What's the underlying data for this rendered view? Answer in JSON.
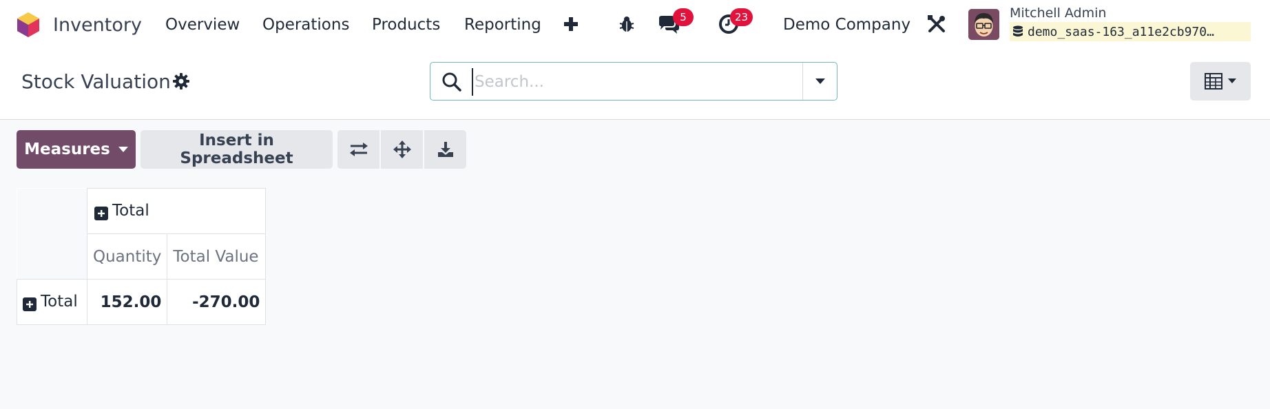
{
  "navbar": {
    "app_name": "Inventory",
    "menu": [
      "Overview",
      "Operations",
      "Products",
      "Reporting"
    ],
    "messages_count": "5",
    "activities_count": "23",
    "company": "Demo Company",
    "user_name": "Mitchell Admin",
    "database": "demo_saas-163_a11e2cb970…"
  },
  "control_panel": {
    "title": "Stock Valuation",
    "search_placeholder": "Search..."
  },
  "toolbar": {
    "measures_label": "Measures",
    "insert_label": "Insert in Spreadsheet"
  },
  "pivot": {
    "col_header": "Total",
    "measures": [
      "Quantity",
      "Total Value"
    ],
    "row_header": "Total",
    "values": [
      "152.00",
      "-270.00"
    ]
  },
  "colors": {
    "primary": "#714b67",
    "badge": "#e1123c",
    "search_border": "#71b7b5"
  },
  "icons": [
    "app-logo-icon",
    "plus-icon",
    "bug-icon",
    "chat-icon",
    "clock-icon",
    "tools-icon",
    "database-icon",
    "gear-icon",
    "search-icon",
    "caret-down-icon",
    "pivot-view-icon",
    "flip-axis-icon",
    "expand-all-icon",
    "download-icon",
    "plus-square-icon"
  ]
}
